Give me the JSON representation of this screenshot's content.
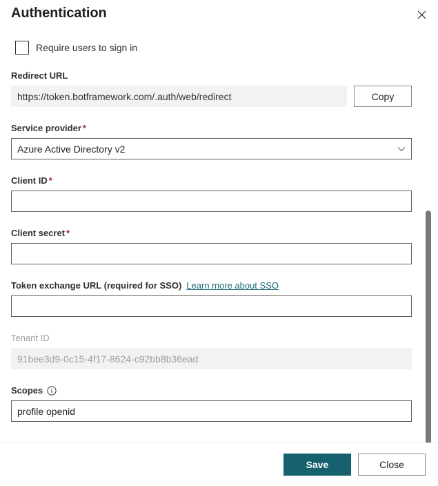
{
  "header": {
    "title": "Authentication",
    "close_icon": "close-icon"
  },
  "form": {
    "require_signin": {
      "label": "Require users to sign in",
      "checked": false
    },
    "redirect_url": {
      "label": "Redirect URL",
      "value": "https://token.botframework.com/.auth/web/redirect",
      "copy_label": "Copy",
      "readonly": true
    },
    "service_provider": {
      "label": "Service provider",
      "required": true,
      "value": "Azure Active Directory v2",
      "chevron_icon": "chevron-down-icon"
    },
    "client_id": {
      "label": "Client ID",
      "required": true,
      "value": "",
      "placeholder": ""
    },
    "client_secret": {
      "label": "Client secret",
      "required": true,
      "value": "",
      "placeholder": ""
    },
    "token_exchange_url": {
      "label": "Token exchange URL (required for SSO)",
      "link_label": "Learn more about SSO",
      "value": "",
      "placeholder": ""
    },
    "tenant_id": {
      "label": "Tenant ID",
      "value": "91bee3d9-0c15-4f17-8624-c92bb8b36ead",
      "disabled": true
    },
    "scopes": {
      "label": "Scopes",
      "info_icon": "info-icon",
      "value": "profile openid",
      "placeholder": ""
    }
  },
  "footer": {
    "save_label": "Save",
    "close_label": "Close"
  },
  "colors": {
    "primary": "#15616d",
    "link": "#1a6b78",
    "required_star": "#a4262c",
    "disabled_text": "#a19f9d",
    "readonly_bg": "#f3f2f1"
  },
  "required_marker": "*"
}
